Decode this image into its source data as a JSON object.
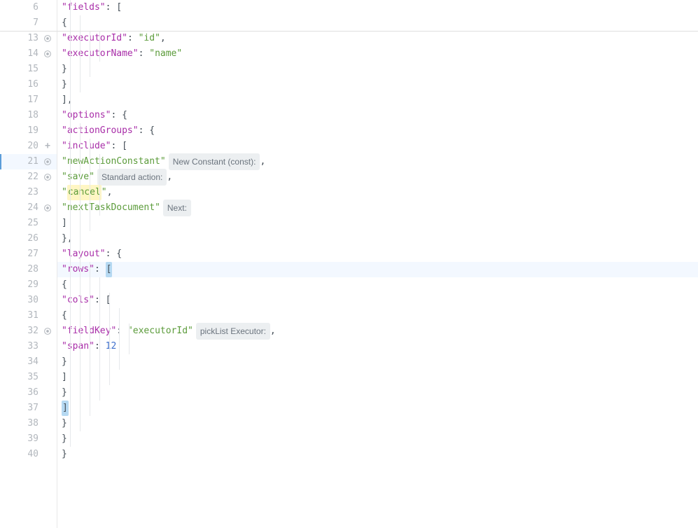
{
  "lines": [
    {
      "num": 6,
      "icon": null
    },
    {
      "num": 7,
      "icon": null
    },
    {
      "num": 13,
      "icon": "eye"
    },
    {
      "num": 14,
      "icon": "eye"
    },
    {
      "num": 15,
      "icon": null
    },
    {
      "num": 16,
      "icon": null
    },
    {
      "num": 17,
      "icon": null
    },
    {
      "num": 18,
      "icon": null
    },
    {
      "num": 19,
      "icon": null
    },
    {
      "num": 20,
      "icon": "plus"
    },
    {
      "num": 21,
      "icon": "eye",
      "highlighted": true
    },
    {
      "num": 22,
      "icon": "eye"
    },
    {
      "num": 23,
      "icon": null
    },
    {
      "num": 24,
      "icon": "eye"
    },
    {
      "num": 25,
      "icon": null
    },
    {
      "num": 26,
      "icon": null
    },
    {
      "num": 27,
      "icon": null
    },
    {
      "num": 28,
      "icon": null,
      "row_highlight": true
    },
    {
      "num": 29,
      "icon": null
    },
    {
      "num": 30,
      "icon": null
    },
    {
      "num": 31,
      "icon": null
    },
    {
      "num": 32,
      "icon": "eye"
    },
    {
      "num": 33,
      "icon": null
    },
    {
      "num": 34,
      "icon": null
    },
    {
      "num": 35,
      "icon": null
    },
    {
      "num": 36,
      "icon": null
    },
    {
      "num": 37,
      "icon": null
    },
    {
      "num": 38,
      "icon": null
    },
    {
      "num": 39,
      "icon": null
    },
    {
      "num": 40,
      "icon": null
    }
  ],
  "code": {
    "l6": {
      "keys": [
        "fields"
      ],
      "tail": ": ["
    },
    "l7": {
      "brace": "{"
    },
    "l13": {
      "keys": [
        "executorId"
      ],
      "vals": [
        "id"
      ],
      "comma": true
    },
    "l14": {
      "keys": [
        "executorName"
      ],
      "vals": [
        "name"
      ]
    },
    "l15": {
      "brace": "}"
    },
    "l16": {
      "brace": "}"
    },
    "l17": {
      "text": "],"
    },
    "l18": {
      "keys": [
        "options"
      ],
      "tail": ": {"
    },
    "l19": {
      "keys": [
        "actionGroups"
      ],
      "tail": ": {"
    },
    "l20": {
      "keys": [
        "include"
      ],
      "tail": ": ["
    },
    "l21": {
      "vals": [
        "newActionConstant"
      ],
      "hint": "New Constant (const):",
      "comma": true
    },
    "l22": {
      "vals": [
        "save"
      ],
      "hint": "Standard action:",
      "comma": true
    },
    "l23": {
      "vals": [
        "cancel"
      ],
      "highlight_val": true,
      "comma": true
    },
    "l24": {
      "vals": [
        "nextTaskDocument"
      ],
      "hint": "Next:"
    },
    "l25": {
      "text": "]"
    },
    "l26": {
      "text": "},"
    },
    "l27": {
      "keys": [
        "layout"
      ],
      "tail": ": {"
    },
    "l28": {
      "keys": [
        "rows"
      ],
      "tail": ": ",
      "match_bracket": "["
    },
    "l29": {
      "brace": "{"
    },
    "l30": {
      "keys": [
        "cols"
      ],
      "tail": ": ["
    },
    "l31": {
      "brace": "{"
    },
    "l32": {
      "keys": [
        "fieldKey"
      ],
      "vals": [
        "executorId"
      ],
      "hint": "pickList Executor:",
      "comma": true
    },
    "l33": {
      "keys": [
        "span"
      ],
      "num": 12
    },
    "l34": {
      "brace": "}"
    },
    "l35": {
      "text": "]"
    },
    "l36": {
      "brace": "}"
    },
    "l37": {
      "match_bracket": "]"
    },
    "l38": {
      "brace": "}"
    },
    "l39": {
      "brace": "}"
    },
    "l40": {
      "brace": "}"
    }
  }
}
